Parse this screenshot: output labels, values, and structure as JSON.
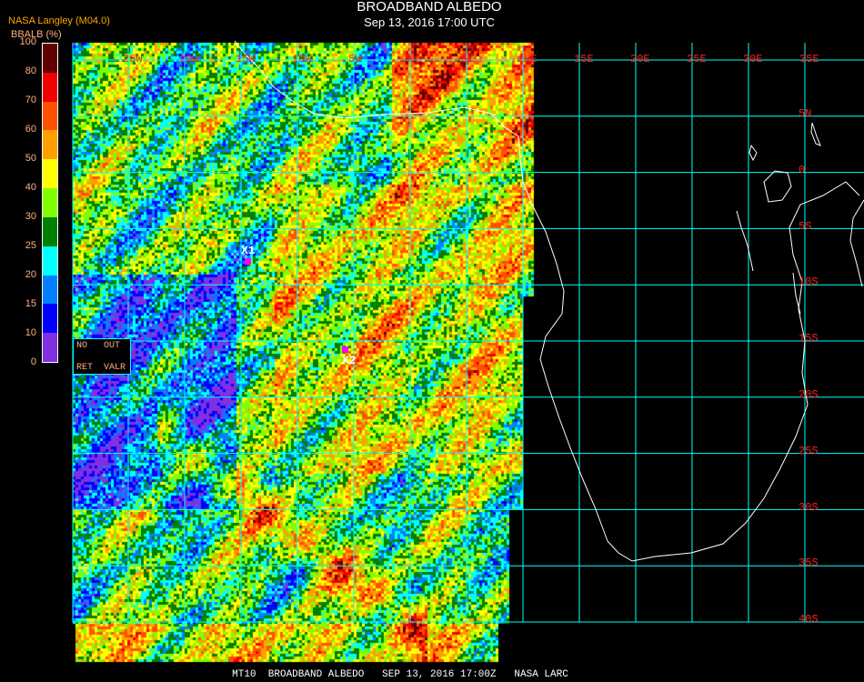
{
  "header": {
    "title": "BROADBAND ALBEDO",
    "subtitle": "Sep 13, 2016 17:00 UTC",
    "producer": "NASA Langley (M04.0)"
  },
  "legend": {
    "unit_label": "BBALB (%)",
    "ticks": [
      "100",
      "80",
      "70",
      "60",
      "50",
      "40",
      "30",
      "25",
      "20",
      "15",
      "10",
      "0"
    ],
    "colors": [
      "#600000",
      "#f00000",
      "#ff5000",
      "#ffa000",
      "#ffff00",
      "#80ff00",
      "#008000",
      "#00ffff",
      "#0080ff",
      "#0000ff",
      "#8030e0"
    ]
  },
  "qc_legend": {
    "no": "NO",
    "out": "OUT",
    "ret": "RET",
    "valr": "VALR"
  },
  "grid": {
    "color": "#00ffff",
    "longitude_labels": [
      "25W",
      "20W",
      "15W",
      "10W",
      "5W",
      "0",
      "5E",
      "10E",
      "15E",
      "20E",
      "25E",
      "30E",
      "35E"
    ],
    "latitude_labels": [
      "5N",
      "0",
      "5S",
      "10S",
      "15S",
      "20S",
      "25S",
      "30S",
      "35S",
      "40S"
    ]
  },
  "markers": [
    {
      "label": "X1",
      "color": "#ff00ff"
    },
    {
      "label": "X2",
      "color": "#ff00ff"
    }
  ],
  "footer": "MT10  BROADBAND ALBEDO   SEP 13, 2016 17:00Z   NASA LARC"
}
